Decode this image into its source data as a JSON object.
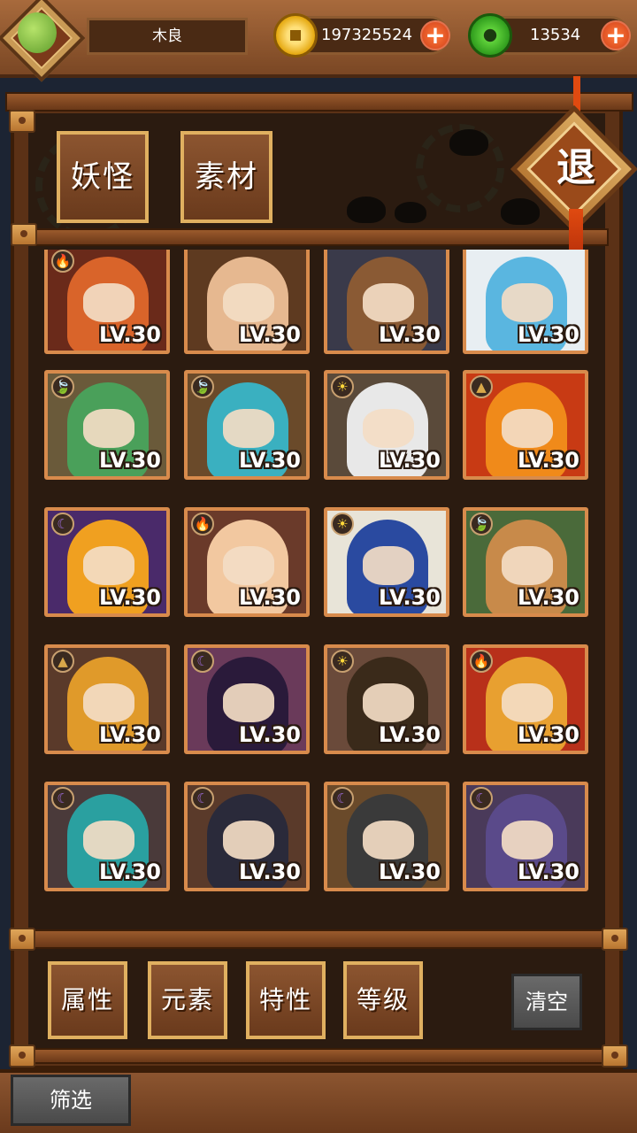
{
  "player": {
    "name": "木良"
  },
  "currency": {
    "gold": "197325524",
    "jade": "13534"
  },
  "tabs": [
    "妖怪",
    "素材"
  ],
  "exit_label": "退",
  "monsters": [
    {
      "level": "LV.30",
      "element": "fire",
      "color": "#d9642a",
      "bg": "#6a2a1a"
    },
    {
      "level": "LV.30",
      "element": "none",
      "color": "#e6b890",
      "bg": "#5e3a20"
    },
    {
      "level": "LV.30",
      "element": "none",
      "color": "#8a5a34",
      "bg": "#3a3a4a"
    },
    {
      "level": "LV.30",
      "element": "none",
      "color": "#5ab6e0",
      "bg": "#e8eef2"
    },
    {
      "level": "LV.30",
      "element": "wood",
      "color": "#4aa05a",
      "bg": "#6a5a3a"
    },
    {
      "level": "LV.30",
      "element": "wood",
      "color": "#3ab0c0",
      "bg": "#6a4a2a"
    },
    {
      "level": "LV.30",
      "element": "light",
      "color": "#e8e8e8",
      "bg": "#5a4a3a"
    },
    {
      "level": "LV.30",
      "element": "earth",
      "color": "#f08a1a",
      "bg": "#c83a14"
    },
    {
      "level": "LV.30",
      "element": "dark",
      "color": "#f0a020",
      "bg": "#4a2a6a"
    },
    {
      "level": "LV.30",
      "element": "fire",
      "color": "#f2c8a0",
      "bg": "#6a3a2a"
    },
    {
      "level": "LV.30",
      "element": "light",
      "color": "#2a4aa0",
      "bg": "#e8e4d8"
    },
    {
      "level": "LV.30",
      "element": "wood",
      "color": "#c88a4a",
      "bg": "#4a6a3a"
    },
    {
      "level": "LV.30",
      "element": "earth",
      "color": "#e09a2a",
      "bg": "#5a3a2a"
    },
    {
      "level": "LV.30",
      "element": "dark",
      "color": "#2a1a3a",
      "bg": "#6a3a5a"
    },
    {
      "level": "LV.30",
      "element": "light",
      "color": "#3a2a1a",
      "bg": "#6a4a3a"
    },
    {
      "level": "LV.30",
      "element": "fire",
      "color": "#e8a030",
      "bg": "#b8301a"
    },
    {
      "level": "LV.30",
      "element": "dark",
      "color": "#2aa0a0",
      "bg": "#4a3a3a"
    },
    {
      "level": "LV.30",
      "element": "dark",
      "color": "#2a2a3a",
      "bg": "#5a3a2a"
    },
    {
      "level": "LV.30",
      "element": "dark",
      "color": "#3a3a3a",
      "bg": "#6a4a2a"
    },
    {
      "level": "LV.30",
      "element": "dark",
      "color": "#5a4a8a",
      "bg": "#4a3a5a"
    }
  ],
  "filters": [
    "属性",
    "元素",
    "特性",
    "等级"
  ],
  "clear_label": "清空",
  "screen_label": "筛选"
}
